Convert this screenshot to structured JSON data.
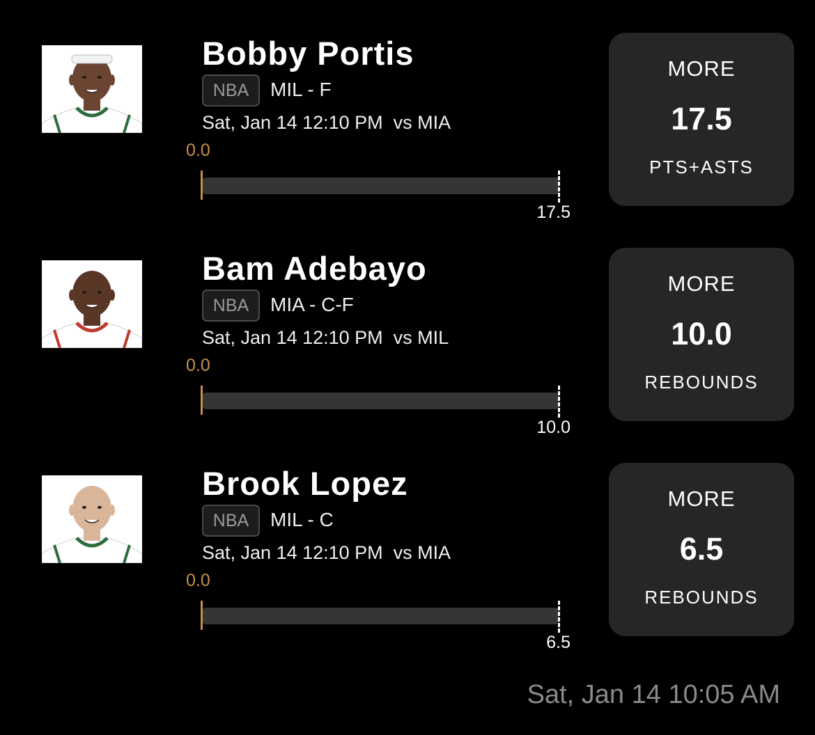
{
  "picks": [
    {
      "player": "Bobby Portis",
      "league": "NBA",
      "team_position": "MIL - F",
      "game_time": "Sat, Jan 14 12:10 PM  vs MIA",
      "current_value": "0.0",
      "progress_fraction": 0,
      "line_value": "17.5",
      "direction": "MORE",
      "stat": "PTS+ASTS",
      "jersey_color": "#ffffff",
      "trim_color": "#2e6b3e",
      "skin_color": "#6b4532",
      "headband": true
    },
    {
      "player": "Bam Adebayo",
      "league": "NBA",
      "team_position": "MIA - C-F",
      "game_time": "Sat, Jan 14 12:10 PM  vs MIL",
      "current_value": "0.0",
      "progress_fraction": 0,
      "line_value": "10.0",
      "direction": "MORE",
      "stat": "REBOUNDS",
      "jersey_color": "#ffffff",
      "trim_color": "#c0392b",
      "skin_color": "#5a3626",
      "headband": false
    },
    {
      "player": "Brook Lopez",
      "league": "NBA",
      "team_position": "MIL - C",
      "game_time": "Sat, Jan 14 12:10 PM  vs MIA",
      "current_value": "0.0",
      "progress_fraction": 0,
      "line_value": "6.5",
      "direction": "MORE",
      "stat": "REBOUNDS",
      "jersey_color": "#ffffff",
      "trim_color": "#2e6b3e",
      "skin_color": "#d9b59a",
      "headband": false
    }
  ],
  "timestamp": "Sat, Jan 14 10:05 AM",
  "colors": {
    "background": "#000000",
    "card": "#262626",
    "accent": "#c8904a",
    "track": "#353535",
    "muted": "#8a8a8a"
  }
}
